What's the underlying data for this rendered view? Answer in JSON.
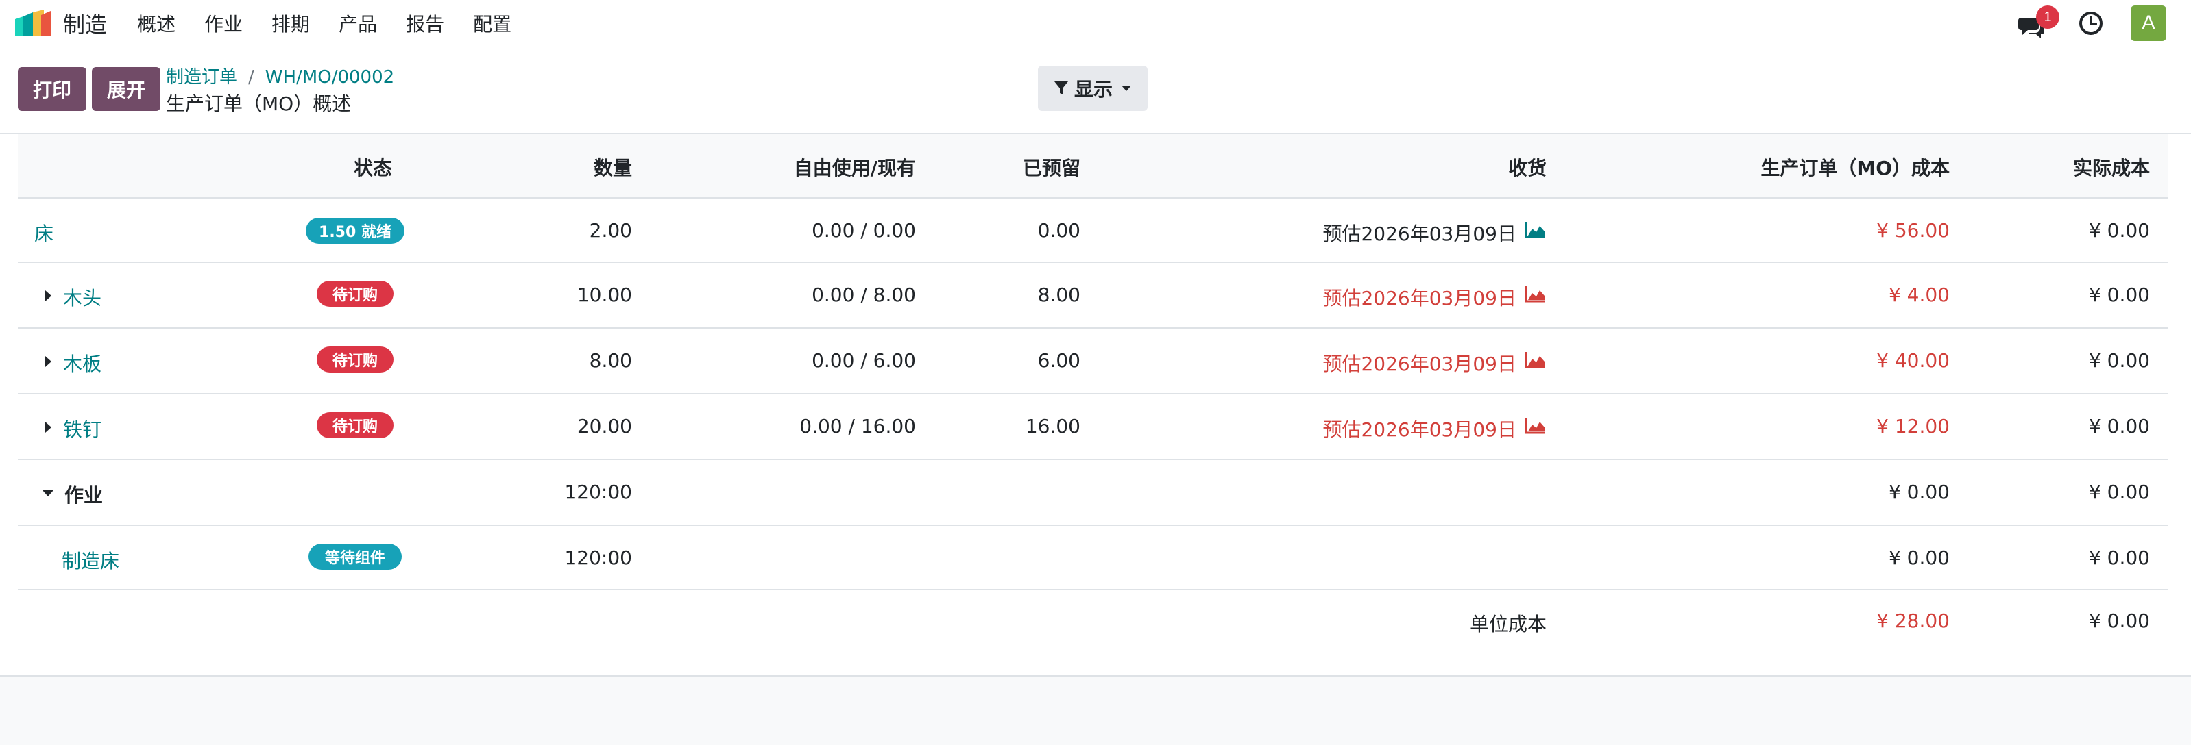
{
  "navbar": {
    "app_name": "制造",
    "app_icon": "manufacturing-app-icon",
    "menu": [
      "概述",
      "作业",
      "排期",
      "产品",
      "报告",
      "配置"
    ],
    "chat_icon": "chat-icon",
    "chat_badge": "1",
    "clock_icon": "clock-icon",
    "avatar": "A",
    "avatar_color": "#74a840"
  },
  "control": {
    "print_label": "打印",
    "expand_label": "展开",
    "breadcrumb": [
      "制造订单",
      "WH/MO/00002"
    ],
    "subtitle": "生产订单（MO）概述",
    "display_label": "显示",
    "display_icon": "filter-icon"
  },
  "table": {
    "headers": [
      "状态",
      "数量",
      "自由使用/现有",
      "已预留",
      "收货",
      "生产订单（MO）成本",
      "实际成本"
    ],
    "rows": [
      {
        "name": "床",
        "status": "1.50 就绪",
        "qty": "2.00",
        "free": "0.00 / 0.00",
        "reserved": "0.00",
        "receipt": "预估2026年03月09日",
        "mo_cost": "¥ 56.00",
        "real_cost": "¥ 0.00"
      },
      {
        "name": "木头",
        "status": "待订购",
        "qty": "10.00",
        "free": "0.00 / 8.00",
        "reserved": "8.00",
        "receipt": "预估2026年03月09日",
        "mo_cost": "¥ 4.00",
        "real_cost": "¥ 0.00"
      },
      {
        "name": "木板",
        "status": "待订购",
        "qty": "8.00",
        "free": "0.00 / 6.00",
        "reserved": "6.00",
        "receipt": "预估2026年03月09日",
        "mo_cost": "¥ 40.00",
        "real_cost": "¥ 0.00"
      },
      {
        "name": "铁钉",
        "status": "待订购",
        "qty": "20.00",
        "free": "0.00 / 16.00",
        "reserved": "16.00",
        "receipt": "预估2026年03月09日",
        "mo_cost": "¥ 12.00",
        "real_cost": "¥ 0.00"
      }
    ],
    "operations": {
      "label": "作业",
      "qty": "120:00",
      "mo_cost": "¥ 0.00",
      "real_cost": "¥ 0.00"
    },
    "operation_row": {
      "name": "制造床",
      "status": "等待组件",
      "qty": "120:00",
      "mo_cost": "¥ 0.00",
      "real_cost": "¥ 0.00"
    },
    "unit_cost": {
      "label": "单位成本",
      "mo_cost": "¥ 28.00",
      "real_cost": "¥ 0.00"
    }
  },
  "colors": {
    "primary": "#714b67",
    "link": "#017e84",
    "danger": "#d23f3a",
    "info": "#17a2b8",
    "red_badge": "#dc3545"
  }
}
